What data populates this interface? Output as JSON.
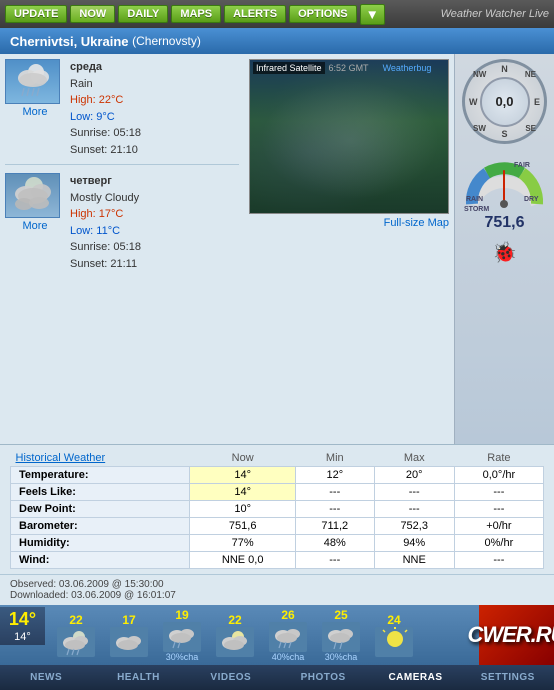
{
  "app": {
    "title": "Weather Watcher Live"
  },
  "toolbar": {
    "buttons": [
      {
        "label": "UPDATE",
        "id": "update"
      },
      {
        "label": "NOW",
        "id": "now"
      },
      {
        "label": "DAILY",
        "id": "daily"
      },
      {
        "label": "MAPS",
        "id": "maps"
      },
      {
        "label": "ALERTS",
        "id": "alerts"
      },
      {
        "label": "OPTIONS",
        "id": "options"
      }
    ]
  },
  "location": {
    "city": "Chernivtsi, Ukraine",
    "local": "(Chernovsty)"
  },
  "days": [
    {
      "name": "среда",
      "condition": "Rain",
      "high": "High: 22°C",
      "low": "Low: 9°C",
      "sunrise": "Sunrise: 05:18",
      "sunset": "Sunset: 21:10",
      "more": "More"
    },
    {
      "name": "четверг",
      "condition": "Mostly Cloudy",
      "high": "High: 17°C",
      "low": "Low: 11°C",
      "sunrise": "Sunrise: 05:18",
      "sunset": "Sunset: 21:11",
      "more": "More"
    }
  ],
  "map": {
    "label": "Infrared Satellite",
    "time": "6:52 GMT",
    "brand": "Weatherbug",
    "fullsize": "Full-size Map"
  },
  "compass": {
    "value": "0,0",
    "directions": {
      "n": "N",
      "ne": "NE",
      "e": "E",
      "se": "SE",
      "s": "S",
      "sw": "SW",
      "w": "W",
      "nw": "NW"
    }
  },
  "barometer": {
    "value": "751,6",
    "labels": {
      "rain": "RAIN",
      "storm": "STORM",
      "fair": "FAIR",
      "dry": "DRY"
    }
  },
  "table": {
    "header": {
      "historical": "Historical Weather",
      "now": "Now",
      "min": "Min",
      "max": "Max",
      "rate": "Rate"
    },
    "rows": [
      {
        "label": "Temperature:",
        "now": "14°",
        "min": "12°",
        "max": "20°",
        "rate": "0,0°/hr",
        "highlight": true
      },
      {
        "label": "Feels Like:",
        "now": "14°",
        "min": "---",
        "max": "---",
        "rate": "---",
        "highlight": true
      },
      {
        "label": "Dew Point:",
        "now": "10°",
        "min": "---",
        "max": "---",
        "rate": "---",
        "highlight": false
      },
      {
        "label": "Barometer:",
        "now": "751,6",
        "min": "711,2",
        "max": "752,3",
        "rate": "+0/hr",
        "highlight": false
      },
      {
        "label": "Humidity:",
        "now": "77%",
        "min": "48%",
        "max": "94%",
        "rate": "0%/hr",
        "highlight": false
      },
      {
        "label": "Wind:",
        "now": "NNE 0,0",
        "min": "---",
        "max": "NNE",
        "rate": "---",
        "highlight": false
      }
    ]
  },
  "observed": {
    "line1": "Observed: 03.06.2009 @ 15:30:00",
    "line2": "Downloaded: 03.06.2009 @ 16:01:07"
  },
  "forecast": {
    "current_temp": "14°",
    "current_sub": "14°",
    "items": [
      {
        "temp": "22",
        "percent": "",
        "day": "1"
      },
      {
        "temp": "17",
        "percent": "",
        "day": "2"
      },
      {
        "temp": "19",
        "percent": "30%cha",
        "day": "3"
      },
      {
        "temp": "22",
        "percent": "",
        "day": "4"
      },
      {
        "temp": "26",
        "percent": "40%cha",
        "day": "5"
      },
      {
        "temp": "25",
        "percent": "30%cha",
        "day": "6"
      },
      {
        "temp": "24",
        "percent": "",
        "day": "7"
      }
    ]
  },
  "nav": {
    "items": [
      {
        "label": "NEWS",
        "id": "news"
      },
      {
        "label": "HEALTH",
        "id": "health"
      },
      {
        "label": "VIDEOS",
        "id": "videos"
      },
      {
        "label": "PHOTOS",
        "id": "photos"
      },
      {
        "label": "CAMERAS",
        "id": "cameras"
      },
      {
        "label": "SETTINGS",
        "id": "settings"
      }
    ]
  }
}
